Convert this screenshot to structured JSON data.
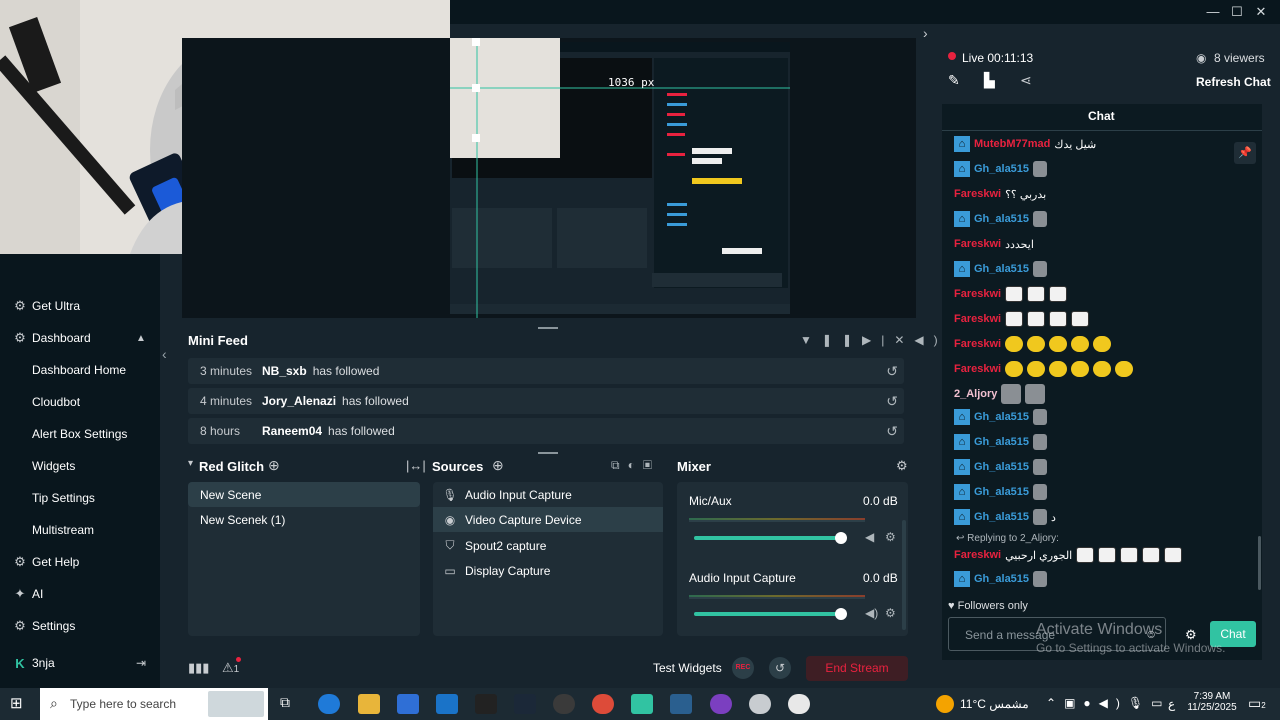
{
  "window": {
    "minimize": "—",
    "maximize": "☐",
    "close": "✕"
  },
  "preview": {
    "dimension_label": "1036 px"
  },
  "sidebar": {
    "items": [
      {
        "label": "Get Ultra",
        "icon": "ultra-icon"
      },
      {
        "label": "Dashboard",
        "icon": "dashboard-icon"
      },
      {
        "label": "Get Help",
        "icon": "help-icon"
      },
      {
        "label": "AI",
        "icon": "ai-icon"
      },
      {
        "label": "Settings",
        "icon": "settings-icon"
      }
    ],
    "dashboard_sub": [
      "Dashboard Home",
      "Cloudbot",
      "Alert Box Settings",
      "Widgets",
      "Tip Settings",
      "Multistream"
    ],
    "user": {
      "name": "3nja"
    }
  },
  "mini_feed": {
    "title": "Mini Feed",
    "rows": [
      {
        "time": "3 minutes",
        "name": "NB_sxb",
        "action": "has followed"
      },
      {
        "time": "4 minutes",
        "name": "Jory_Alenazi",
        "action": "has followed"
      },
      {
        "time": "8 hours",
        "name": "Raneem04",
        "action": "has followed"
      }
    ]
  },
  "scenes": {
    "title": "Red Glitch",
    "items": [
      "New Scene",
      "New Scenek (1)"
    ]
  },
  "sources": {
    "title": "Sources",
    "items": [
      {
        "label": "Audio Input Capture",
        "icon": "mic-icon"
      },
      {
        "label": "Video Capture Device",
        "icon": "webcam-icon"
      },
      {
        "label": "Spout2 capture",
        "icon": "spout-icon"
      },
      {
        "label": "Display Capture",
        "icon": "monitor-icon"
      }
    ]
  },
  "mixer": {
    "title": "Mixer",
    "channels": [
      {
        "label": "Mic/Aux",
        "db": "0.0 dB",
        "level": 0.97
      },
      {
        "label": "Audio Input Capture",
        "db": "0.0 dB",
        "level": 0.97
      }
    ]
  },
  "bottom": {
    "test_widgets": "Test Widgets",
    "rec": "REC",
    "end_stream": "End Stream",
    "alert_count": "1"
  },
  "live": {
    "status": "Live 00:11:13",
    "viewers": "8 viewers",
    "refresh": "Refresh Chat"
  },
  "chat": {
    "title": "Chat",
    "lines": [
      {
        "user": "MutebM77mad",
        "color": "#e8223f",
        "badge": false,
        "msg": "شيل يدك"
      },
      {
        "user": "Gh_ala515",
        "color": "#3a9bd8",
        "badge": true,
        "msg": ""
      },
      {
        "user": "Fareskwi",
        "color": "#e8223f",
        "badge": false,
        "msg": "بدربي ؟؟"
      },
      {
        "user": "Gh_ala515",
        "color": "#3a9bd8",
        "badge": true,
        "msg": ""
      },
      {
        "user": "Fareskwi",
        "color": "#e8223f",
        "badge": false,
        "msg": "ايحددد"
      },
      {
        "user": "Gh_ala515",
        "color": "#3a9bd8",
        "badge": true,
        "msg": ""
      },
      {
        "user": "Fareskwi",
        "color": "#e8223f",
        "badge": false,
        "msg": ""
      },
      {
        "user": "Fareskwi",
        "color": "#e8223f",
        "badge": false,
        "msg": ""
      },
      {
        "user": "Fareskwi",
        "color": "#e8223f",
        "badge": false,
        "msg": ""
      },
      {
        "user": "Fareskwi",
        "color": "#e8223f",
        "badge": false,
        "msg": ""
      },
      {
        "user": "2_Aljory",
        "color": "#f2c1d1",
        "badge": false,
        "msg": ""
      },
      {
        "user": "Gh_ala515",
        "color": "#3a9bd8",
        "badge": true,
        "msg": ""
      },
      {
        "user": "Gh_ala515",
        "color": "#3a9bd8",
        "badge": true,
        "msg": ""
      },
      {
        "user": "Gh_ala515",
        "color": "#3a9bd8",
        "badge": true,
        "msg": ""
      },
      {
        "user": "Gh_ala515",
        "color": "#3a9bd8",
        "badge": true,
        "msg": ""
      },
      {
        "user": "Gh_ala515",
        "color": "#3a9bd8",
        "badge": true,
        "msg": "د"
      }
    ],
    "reply_to": "Replying to 2_Aljory:",
    "reply_user": "Fareskwi",
    "reply_msg": "الجوري ارحبيي",
    "last_user": "Gh_ala515",
    "followers_only": "Followers only",
    "input_placeholder": "Send a message",
    "send": "Chat",
    "watermark_title": "Activate Windows",
    "watermark_sub": "Go to Settings to activate Windows."
  },
  "taskbar": {
    "search_placeholder": "Type here to search",
    "weather": "11°C  مشمس",
    "time": "7:39 AM",
    "date": "11/25/2025",
    "lang": "ع",
    "notification_count": "2"
  }
}
